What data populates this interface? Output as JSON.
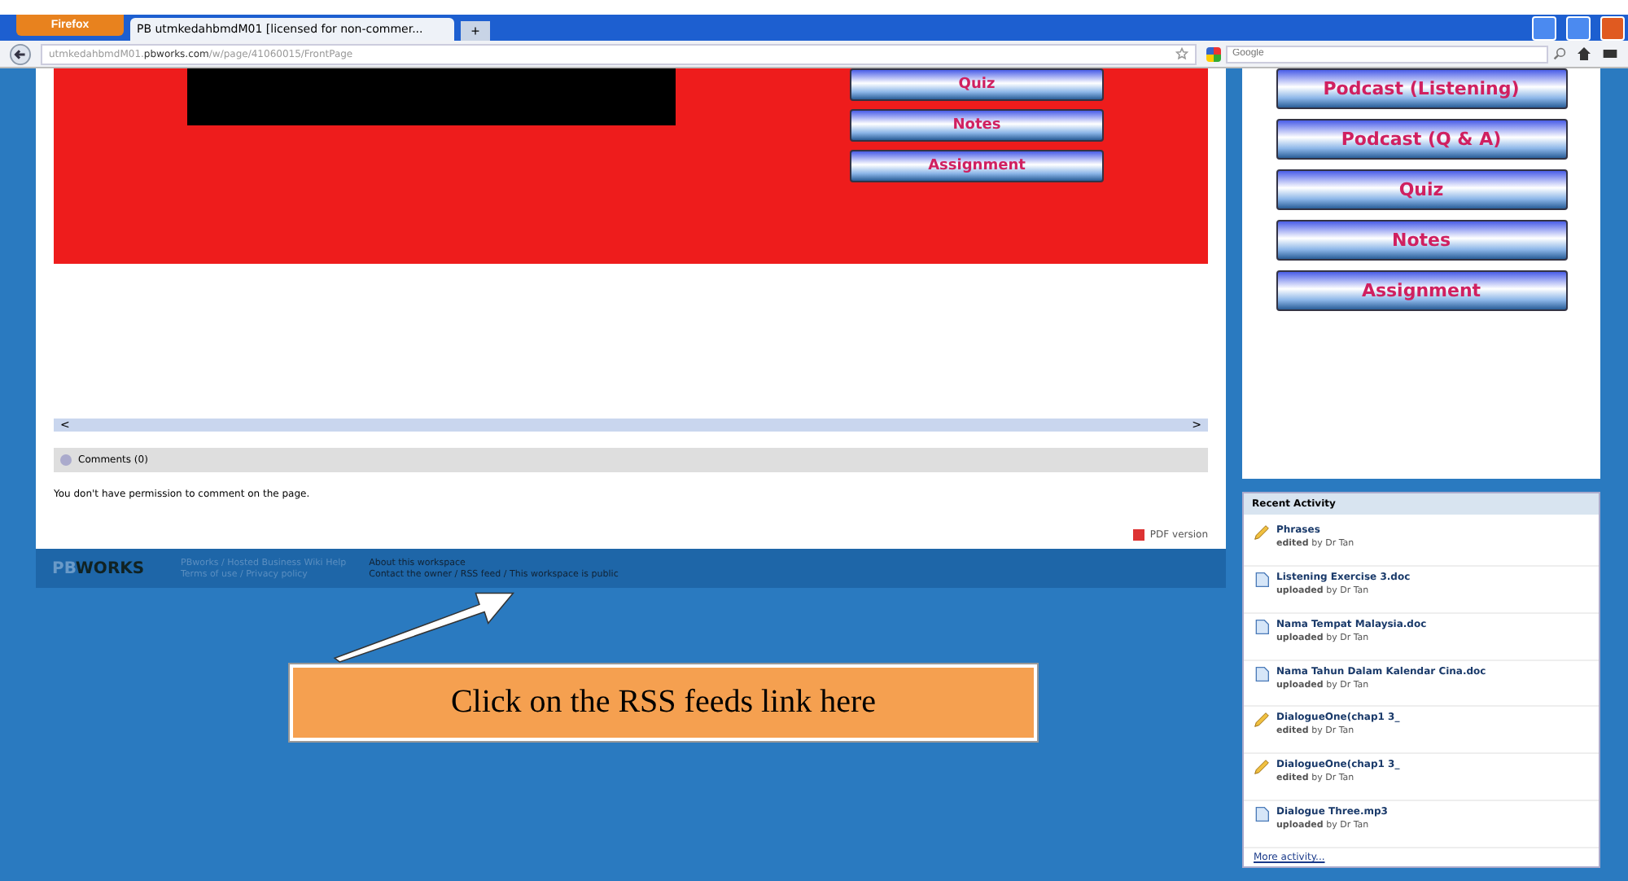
{
  "browser": {
    "menu_button": "Firefox",
    "tab_title": "PB utmkedahbmdM01 [licensed for non-commer...",
    "new_tab": "+",
    "url_host": "utmkedahbmdM01.",
    "url_domain": "pbworks.com",
    "url_path": "/w/page/41060015/FrontPage",
    "search_placeholder": "Google"
  },
  "main_buttons": [
    "Quiz",
    "Notes",
    "Assignment"
  ],
  "comments": {
    "title": "Comments (0)",
    "message": "You don't have permission to comment on the page."
  },
  "scroll_arrows": [
    "<",
    ">"
  ],
  "pdf_link": "PDF version",
  "footer": {
    "logo_left": "PB",
    "logo_right": "WORKS",
    "links": [
      "PBworks / Hosted Business Wiki Help",
      "Terms of use / Privacy policy",
      "About this workspace",
      "Contact the owner / RSS feed / This workspace is public"
    ]
  },
  "sidebar_buttons": [
    "Podcast (Listening)",
    "Podcast (Q & A)",
    "Quiz",
    "Notes",
    "Assignment"
  ],
  "recent_activity": {
    "title": "Recent Activity",
    "items": [
      {
        "kind": "page",
        "name": "Phrases",
        "action": "edited",
        "by": "by Dr Tan"
      },
      {
        "kind": "file",
        "name": "Listening Exercise 3.doc",
        "action": "uploaded",
        "by": "by Dr Tan"
      },
      {
        "kind": "file",
        "name": "Nama Tempat Malaysia.doc",
        "action": "uploaded",
        "by": "by Dr Tan"
      },
      {
        "kind": "file",
        "name": "Nama Tahun Dalam Kalendar Cina.doc",
        "action": "uploaded",
        "by": "by Dr Tan"
      },
      {
        "kind": "page",
        "name": "DialogueOne(chap1 3_",
        "action": "edited",
        "by": "by Dr Tan"
      },
      {
        "kind": "page",
        "name": "DialogueOne(chap1 3_",
        "action": "edited",
        "by": "by Dr Tan"
      },
      {
        "kind": "file",
        "name": "Dialogue Three.mp3",
        "action": "uploaded",
        "by": "by Dr Tan"
      }
    ],
    "more": "More activity..."
  },
  "callout": "Click on the RSS feeds link here"
}
